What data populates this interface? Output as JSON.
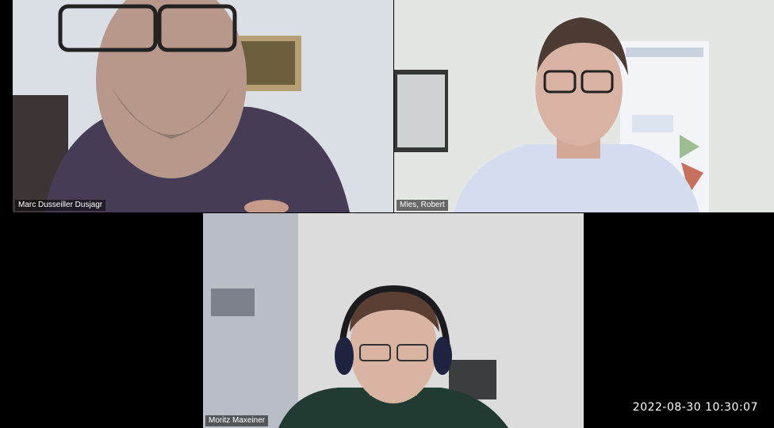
{
  "participants": [
    {
      "name": "Marc Dusseiller Dusjagr"
    },
    {
      "name": "Mies, Robert"
    },
    {
      "name": "Moritz Maxeiner"
    }
  ],
  "timestamp": "2022-08-30  10:30:07"
}
